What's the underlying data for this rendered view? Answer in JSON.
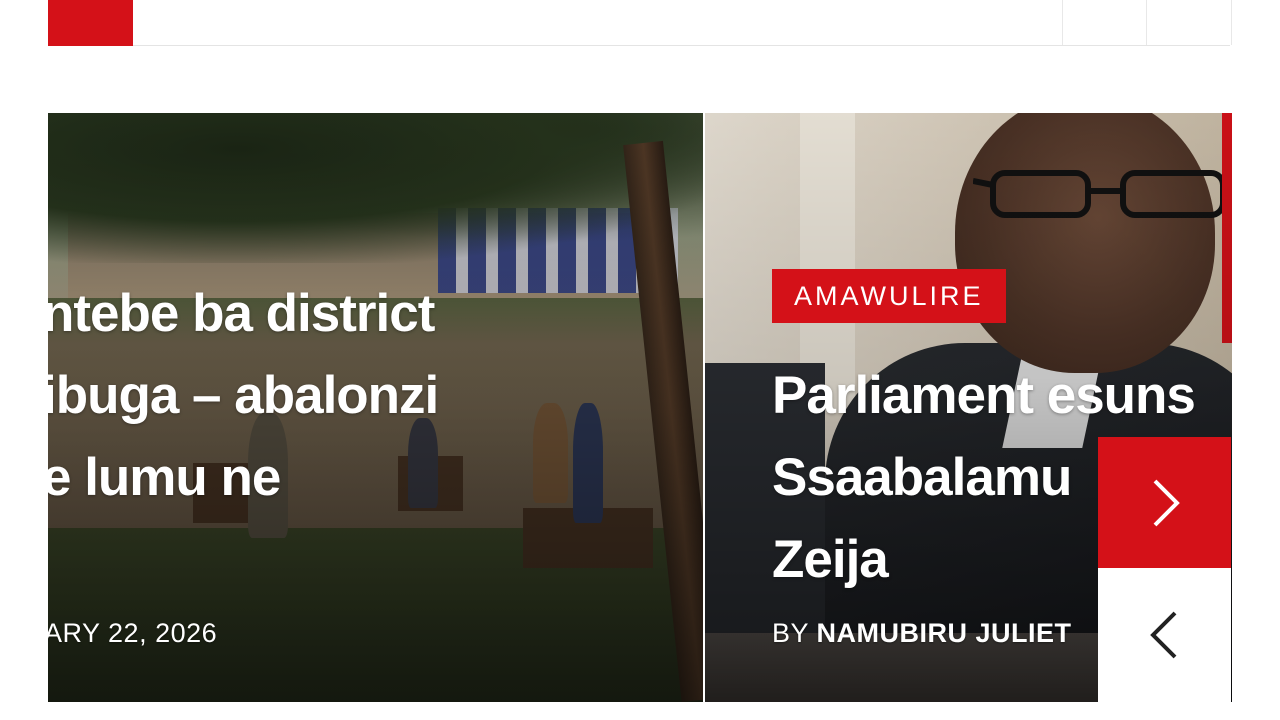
{
  "header": {
    "brand_color": "#d41118"
  },
  "slider": {
    "slides": [
      {
        "headline_lines": [
          "ntebe ba district",
          "ibuga – abalonzi",
          "e lumu ne"
        ],
        "date": "ARY 22, 2026"
      },
      {
        "category": "AMAWULIRE",
        "headline_lines": [
          "Parliament esuns",
          "Ssaabalamu",
          "Zeija"
        ],
        "byline_prefix": "BY ",
        "author": "NAMUBIRU JULIET"
      }
    ],
    "controls": {
      "next_icon": "chevron-right-icon",
      "prev_icon": "chevron-left-icon"
    }
  },
  "colors": {
    "accent": "#d41118",
    "text_on_image": "#ffffff"
  }
}
